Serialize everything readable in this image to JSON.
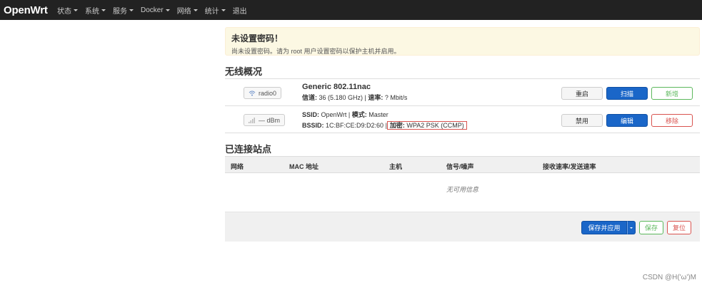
{
  "navbar": {
    "brand": "OpenWrt",
    "items": [
      {
        "label": "状态",
        "dropdown": true
      },
      {
        "label": "系统",
        "dropdown": true
      },
      {
        "label": "服务",
        "dropdown": true
      },
      {
        "label": "Docker",
        "dropdown": true
      },
      {
        "label": "网络",
        "dropdown": true
      },
      {
        "label": "统计",
        "dropdown": true
      },
      {
        "label": "退出",
        "dropdown": false
      }
    ]
  },
  "alert": {
    "title": "未设置密码！",
    "text": "尚未设置密码。请为 root 用户设置密码以保护主机并启用。"
  },
  "wireless": {
    "title": "无线概况",
    "radio": {
      "badge": "radio0",
      "name": "Generic 802.11nac",
      "channel_label": "信道:",
      "channel_value": "36 (5.180 GHz)",
      "rate_label": "速率:",
      "rate_value": "? Mbit/s",
      "buttons": [
        "重启",
        "扫描",
        "新增"
      ]
    },
    "network": {
      "badge": "— dBm",
      "ssid_label": "SSID:",
      "ssid_value": "OpenWrt",
      "mode_label": "模式:",
      "mode_value": "Master",
      "bssid_label": "BSSID:",
      "bssid_value": "1C:BF:CE:D9:D2:60",
      "enc_label": "加密:",
      "enc_value": "WPA2 PSK (CCMP)",
      "buttons": [
        "禁用",
        "编辑",
        "移除"
      ]
    }
  },
  "stations": {
    "title": "已连接站点",
    "columns": [
      "网络",
      "MAC 地址",
      "主机",
      "信号/噪声",
      "接收速率/发送速率"
    ],
    "empty_text": "无可用信息"
  },
  "footer": {
    "apply_label": "保存并应用",
    "save_label": "保存",
    "reset_label": "复位"
  },
  "watermark": "CSDN @H('ω')M",
  "colors": {
    "navbar": "#222222",
    "primary": "#1a66c8",
    "success": "#5cb85c",
    "danger": "#d9534f",
    "alert_bg": "#fcf8e3"
  }
}
